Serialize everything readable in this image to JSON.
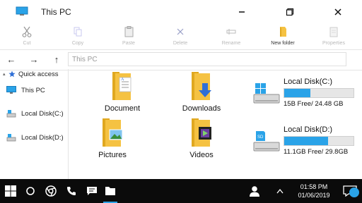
{
  "window": {
    "title": "This PC"
  },
  "ribbon": [
    {
      "label": "Cut",
      "icon": "scissors-icon",
      "enabled": false
    },
    {
      "label": "Copy",
      "icon": "copy-icon",
      "enabled": false
    },
    {
      "label": "Paste",
      "icon": "clipboard-icon",
      "enabled": false
    },
    {
      "label": "Delete",
      "icon": "x-icon",
      "enabled": false
    },
    {
      "label": "Rename",
      "icon": "rename-icon",
      "enabled": false
    },
    {
      "label": "New folder",
      "icon": "new-folder-icon",
      "enabled": true
    },
    {
      "label": "Properties",
      "icon": "properties-icon",
      "enabled": false
    }
  ],
  "nav": {
    "back_icon": "←",
    "forward_icon": "→",
    "up_icon": "↑",
    "address_placeholder": "This PC"
  },
  "sidebar": {
    "quick_access": {
      "arrow": "▴",
      "label": "Quick access"
    },
    "items": [
      {
        "label": "This PC",
        "icon": "monitor-icon"
      },
      {
        "label": "Local Disk(C:)",
        "icon": "disk-icon"
      },
      {
        "label": "Local Disk(D:)",
        "icon": "disk-icon"
      }
    ]
  },
  "folders": [
    {
      "label": "Document",
      "icon": "document-folder-icon"
    },
    {
      "label": "Downloads",
      "icon": "downloads-folder-icon"
    },
    {
      "label": "Pictures",
      "icon": "pictures-folder-icon"
    },
    {
      "label": "Videos",
      "icon": "videos-folder-icon"
    }
  ],
  "disks": [
    {
      "name": "Local Disk(C:)",
      "free_text": "15B Free/ 24.48 GB",
      "used_fraction": 0.38,
      "icon": "windows-disk-icon"
    },
    {
      "name": "Local Disk(D:)",
      "free_text": "11.1GB Free/ 29.8GB",
      "used_fraction": 0.63,
      "icon": "sd-disk-icon"
    }
  ],
  "taskbar": {
    "time": "01:58 PM",
    "date": "01/06/2019"
  },
  "colors": {
    "accent": "#2aa3e8",
    "folder": "#f5c242",
    "taskbar": "#0b0b0b"
  }
}
